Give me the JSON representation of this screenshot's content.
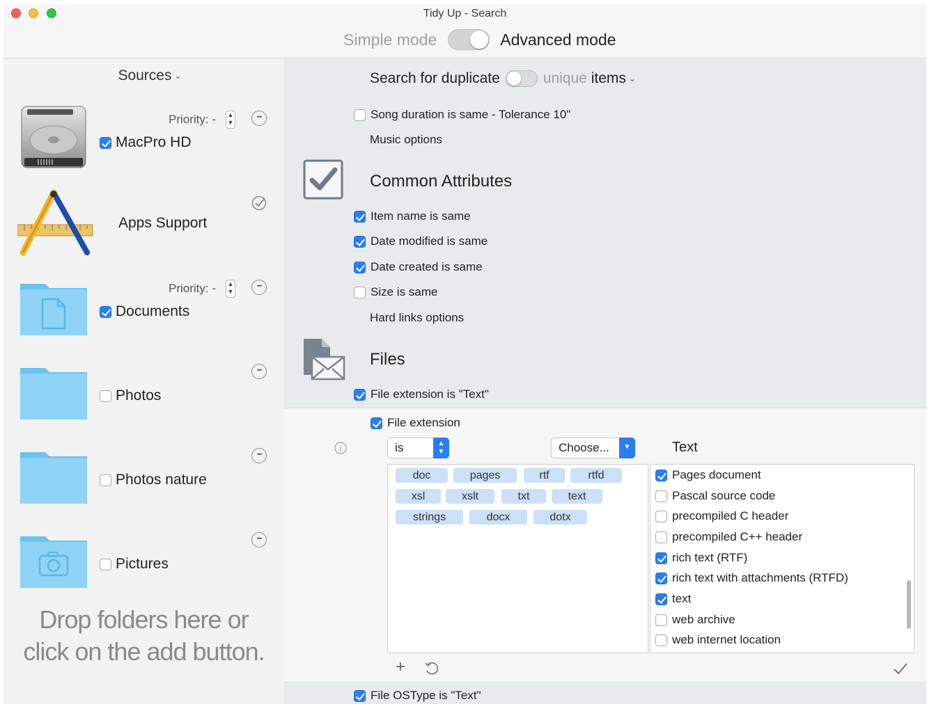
{
  "window": {
    "title": "Tidy Up - Search",
    "simple_mode": "Simple mode",
    "advanced_mode": "Advanced mode"
  },
  "sidebar": {
    "title": "Sources",
    "drop_line1": "Drop folders here or",
    "drop_line2": "click on the add button.",
    "sources": [
      {
        "label": "MacPro HD",
        "checked": true,
        "priority": "Priority: -",
        "icon": "hard-disk-icon"
      },
      {
        "label": "Apps Support",
        "icon": "applications-icon"
      },
      {
        "label": "Documents",
        "checked": true,
        "priority": "Priority: -",
        "icon": "documents-folder-icon"
      },
      {
        "label": "Photos",
        "checked": false,
        "icon": "folder-icon"
      },
      {
        "label": "Photos nature",
        "checked": false,
        "icon": "folder-icon"
      },
      {
        "label": "Pictures",
        "checked": false,
        "icon": "pictures-folder-icon"
      }
    ]
  },
  "main": {
    "search_for_duplicate": "Search for duplicate",
    "unique": "unique",
    "items": "items",
    "song_duration": "Song duration is same - Tolerance 10\"",
    "music_options": "Music options",
    "common_attributes": "Common Attributes",
    "item_name": "Item name is same",
    "date_modified": "Date modified is same",
    "date_created": "Date created is same",
    "size_same": "Size is same",
    "hard_links": "Hard links options",
    "files": "Files",
    "file_extension_is": "File extension is \"Text\"",
    "file_ostype": "File OSType is \"Text\"",
    "panel": {
      "file_extension": "File extension",
      "operator": "is",
      "choose": "Choose...",
      "type_label": "Text",
      "tags": [
        "doc",
        "pages",
        "rtf",
        "rtfd",
        "xsl",
        "xslt",
        "txt",
        "text",
        "strings",
        "docx",
        "dotx"
      ],
      "types": [
        {
          "label": "Pages document",
          "checked": true
        },
        {
          "label": "Pascal source code",
          "checked": false
        },
        {
          "label": "precompiled C header",
          "checked": false
        },
        {
          "label": "precompiled C++ header",
          "checked": false
        },
        {
          "label": "rich text (RTF)",
          "checked": true
        },
        {
          "label": "rich text with attachments (RTFD)",
          "checked": true
        },
        {
          "label": "text",
          "checked": true
        },
        {
          "label": "web archive",
          "checked": false
        },
        {
          "label": "web internet location",
          "checked": false
        }
      ]
    }
  },
  "colors": {
    "accent": "#2a7ef2",
    "tag": "#cce0f7"
  }
}
